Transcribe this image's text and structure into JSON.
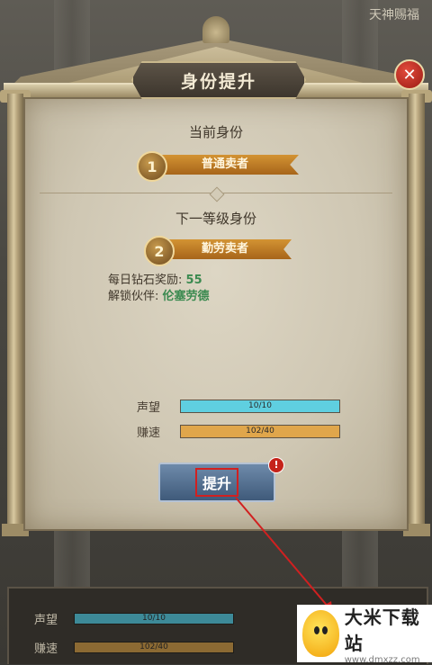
{
  "background": {
    "corner_caption": "天神赐福"
  },
  "modal": {
    "title": "身份提升",
    "current": {
      "heading": "当前身份",
      "rank_number": "1",
      "rank_name": "普通卖者"
    },
    "next": {
      "heading": "下一等级身份",
      "rank_number": "2",
      "rank_name": "勤劳卖者"
    },
    "rewards": {
      "diamond_label": "每日钻石奖励:",
      "diamond_value": "55",
      "partner_label": "解锁伙伴:",
      "partner_value": "伦塞劳德"
    },
    "stats": [
      {
        "label": "声望",
        "text": "10/10",
        "fill_fraction": 1.0,
        "color": "#5fcfe0"
      },
      {
        "label": "赚速",
        "text": "102/40",
        "fill_fraction": 1.0,
        "color": "#e0a64b"
      }
    ],
    "upgrade_label": "提升",
    "alert_mark": "!",
    "close_icon": "close-icon"
  },
  "underlay": {
    "stats": [
      {
        "label": "声望",
        "text": "10/10"
      },
      {
        "label": "赚速",
        "text": "102/40"
      }
    ]
  },
  "watermark": {
    "name": "大米下载站",
    "url": "www.dmxzz.com"
  },
  "colors": {
    "accent_red": "#d12020",
    "reputation_bar": "#5fcfe0",
    "speed_bar": "#e0a64b"
  }
}
